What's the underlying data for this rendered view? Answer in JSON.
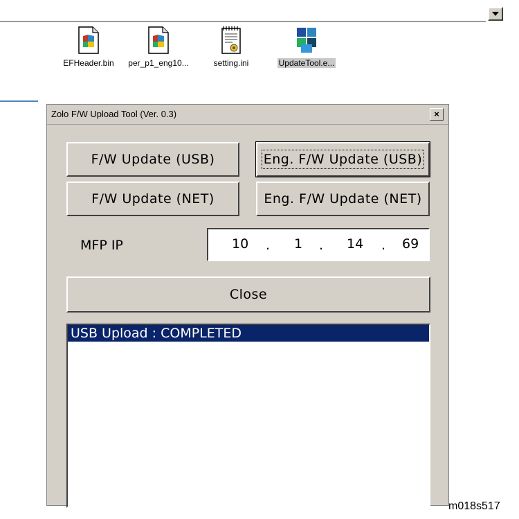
{
  "explorer": {
    "files": [
      {
        "name": "EFHeader.bin",
        "icon": "media-file-icon",
        "selected": false
      },
      {
        "name": "per_p1_eng10...",
        "icon": "media-file-icon",
        "selected": false
      },
      {
        "name": "setting.ini",
        "icon": "ini-settings-file-icon",
        "selected": false
      },
      {
        "name": "UpdateTool.e...",
        "icon": "application-exe-icon",
        "selected": true
      }
    ]
  },
  "dialog": {
    "title": "Zolo F/W Upload Tool (Ver. 0.3)",
    "close_glyph": "×",
    "buttons": {
      "fw_update_usb": "F/W Update (USB)",
      "eng_fw_update_usb": "Eng. F/W Update (USB)",
      "fw_update_net": "F/W Update (NET)",
      "eng_fw_update_net": "Eng. F/W Update (NET)",
      "close": "Close"
    },
    "mfp_ip": {
      "label": "MFP IP",
      "octets": [
        "10",
        "1",
        "14",
        "69"
      ],
      "separator": "."
    },
    "log": [
      "USB Upload : COMPLETED"
    ]
  },
  "caption": "m018s517",
  "colors": {
    "dialog_face": "#d4d0c8",
    "selection": "#0a246a",
    "accent_line": "#4f81bd"
  }
}
